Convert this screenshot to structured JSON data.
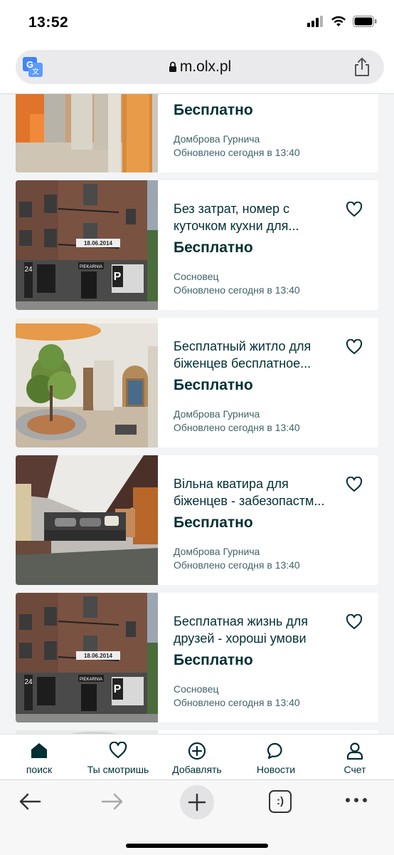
{
  "status": {
    "time": "13:52"
  },
  "browser": {
    "url": "m.olx.pl"
  },
  "listings": [
    {
      "title": "",
      "price": "Бесплатно",
      "location": "Домброва Гурнича",
      "updated": "Обновлено сегодня в 13:40"
    },
    {
      "title": "Без затрат, номер с куточком кухни для...",
      "title_line1": "Без затрат, номер с",
      "title_line2": "куточком кухни для...",
      "price": "Бесплатно",
      "location": "Сосновец",
      "updated": "Обновлено сегодня в 13:40"
    },
    {
      "title": "Бесплатный житло для біженцев бесплатное...",
      "title_line1": "Бесплатный житло для",
      "title_line2": "біженцев бесплатное...",
      "price": "Бесплатно",
      "location": "Домброва Гурнича",
      "updated": "Обновлено сегодня в 13:40"
    },
    {
      "title": "Вільна кватира для біженцев - забезопастм...",
      "title_line1": "Вільна кватира для",
      "title_line2": "біженцев - забезопастм...",
      "price": "Бесплатно",
      "location": "Домброва Гурнича",
      "updated": "Обновлено сегодня в 13:40"
    },
    {
      "title": "Бесплатная жизнь для друзей - хороші умови",
      "title_line1": "Бесплатная жизнь для",
      "title_line2": "друзей - хороші умови",
      "price": "Бесплатно",
      "location": "Сосновец",
      "updated": "Обновлено сегодня в 13:40"
    }
  ],
  "thumb_text": {
    "banner": "18.06.2014",
    "shop_sign": "PIEKARNIA",
    "number": "24",
    "parking": "P"
  },
  "tabs": [
    {
      "label": "поиск",
      "icon": "home-icon",
      "active": true
    },
    {
      "label": "Ты смотришь",
      "icon": "heart-icon"
    },
    {
      "label": "Добавлять",
      "icon": "add-circle-icon"
    },
    {
      "label": "Новости",
      "icon": "chat-icon"
    },
    {
      "label": "Счет",
      "icon": "user-icon"
    }
  ],
  "toolbar": {
    "tabs_icon_label": ":)"
  },
  "colors": {
    "brand_dark": "#002f34",
    "text_muted": "#406367",
    "list_bg": "#f2f4f5"
  }
}
